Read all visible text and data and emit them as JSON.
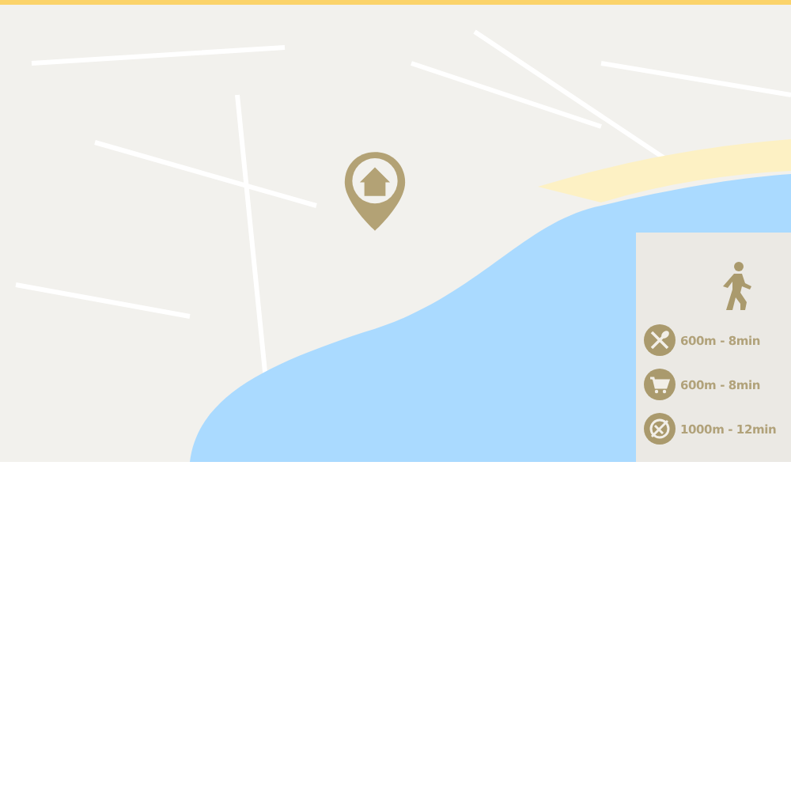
{
  "distance_panel": {
    "rows": [
      {
        "kind": "restaurant",
        "text": "600m - 8min"
      },
      {
        "kind": "shop",
        "text": "600m - 8min"
      },
      {
        "kind": "ball",
        "text": "1000m - 12min"
      }
    ]
  }
}
